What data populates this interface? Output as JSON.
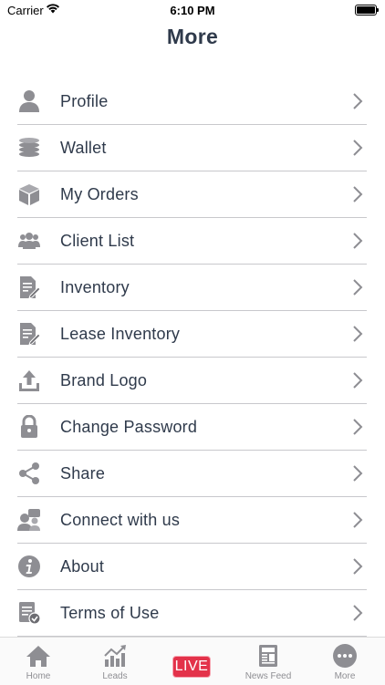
{
  "status_bar": {
    "carrier": "Carrier",
    "time": "6:10 PM"
  },
  "header": {
    "title": "More"
  },
  "menu": {
    "items": [
      {
        "label": "Profile",
        "icon": "profile-icon"
      },
      {
        "label": "Wallet",
        "icon": "coins-icon"
      },
      {
        "label": "My Orders",
        "icon": "box-icon"
      },
      {
        "label": "Client List",
        "icon": "users-icon"
      },
      {
        "label": "Inventory",
        "icon": "document-edit-icon"
      },
      {
        "label": "Lease Inventory",
        "icon": "document-edit-icon"
      },
      {
        "label": "Brand Logo",
        "icon": "upload-icon"
      },
      {
        "label": "Change Password",
        "icon": "lock-icon"
      },
      {
        "label": "Share",
        "icon": "share-icon"
      },
      {
        "label": "Connect with us",
        "icon": "chat-users-icon"
      },
      {
        "label": "About",
        "icon": "info-icon"
      },
      {
        "label": "Terms of Use",
        "icon": "terms-icon"
      }
    ]
  },
  "tabbar": {
    "home": "Home",
    "leads": "Leads",
    "live": "LIVE",
    "news_feed": "News Feed",
    "more": "More"
  },
  "colors": {
    "text": "#2f3a4b",
    "icon": "#8e8e93",
    "live": "#e3324a",
    "divider": "#c8c8cc"
  }
}
